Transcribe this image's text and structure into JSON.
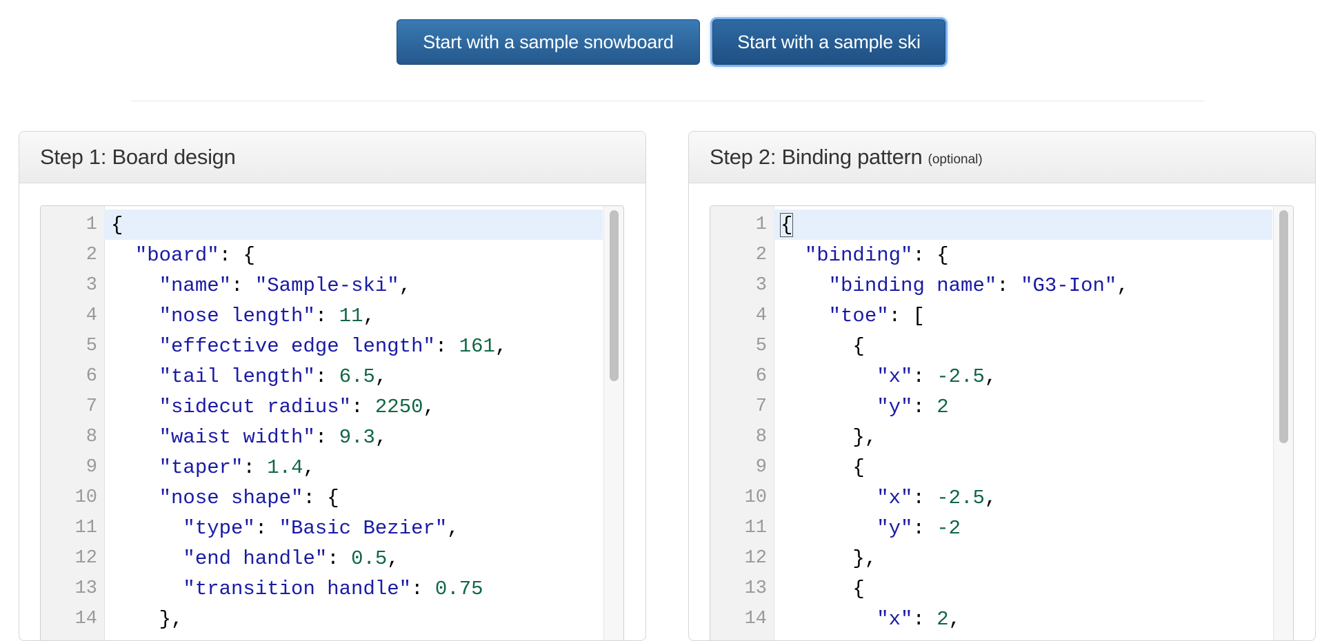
{
  "buttons": {
    "snowboard": "Start with a sample snowboard",
    "ski": "Start with a sample ski"
  },
  "panel1": {
    "title": "Step 1: Board design",
    "lines": [
      [
        [
          "p",
          "{"
        ]
      ],
      [
        [
          "p",
          "  "
        ],
        [
          "k",
          "\"board\""
        ],
        [
          "p",
          ": {"
        ]
      ],
      [
        [
          "p",
          "    "
        ],
        [
          "k",
          "\"name\""
        ],
        [
          "p",
          ": "
        ],
        [
          "s",
          "\"Sample-ski\""
        ],
        [
          "p",
          ","
        ]
      ],
      [
        [
          "p",
          "    "
        ],
        [
          "k",
          "\"nose length\""
        ],
        [
          "p",
          ": "
        ],
        [
          "n",
          "11"
        ],
        [
          "p",
          ","
        ]
      ],
      [
        [
          "p",
          "    "
        ],
        [
          "k",
          "\"effective edge length\""
        ],
        [
          "p",
          ": "
        ],
        [
          "n",
          "161"
        ],
        [
          "p",
          ","
        ]
      ],
      [
        [
          "p",
          "    "
        ],
        [
          "k",
          "\"tail length\""
        ],
        [
          "p",
          ": "
        ],
        [
          "n",
          "6.5"
        ],
        [
          "p",
          ","
        ]
      ],
      [
        [
          "p",
          "    "
        ],
        [
          "k",
          "\"sidecut radius\""
        ],
        [
          "p",
          ": "
        ],
        [
          "n",
          "2250"
        ],
        [
          "p",
          ","
        ]
      ],
      [
        [
          "p",
          "    "
        ],
        [
          "k",
          "\"waist width\""
        ],
        [
          "p",
          ": "
        ],
        [
          "n",
          "9.3"
        ],
        [
          "p",
          ","
        ]
      ],
      [
        [
          "p",
          "    "
        ],
        [
          "k",
          "\"taper\""
        ],
        [
          "p",
          ": "
        ],
        [
          "n",
          "1.4"
        ],
        [
          "p",
          ","
        ]
      ],
      [
        [
          "p",
          "    "
        ],
        [
          "k",
          "\"nose shape\""
        ],
        [
          "p",
          ": {"
        ]
      ],
      [
        [
          "p",
          "      "
        ],
        [
          "k",
          "\"type\""
        ],
        [
          "p",
          ": "
        ],
        [
          "s",
          "\"Basic Bezier\""
        ],
        [
          "p",
          ","
        ]
      ],
      [
        [
          "p",
          "      "
        ],
        [
          "k",
          "\"end handle\""
        ],
        [
          "p",
          ": "
        ],
        [
          "n",
          "0.5"
        ],
        [
          "p",
          ","
        ]
      ],
      [
        [
          "p",
          "      "
        ],
        [
          "k",
          "\"transition handle\""
        ],
        [
          "p",
          ": "
        ],
        [
          "n",
          "0.75"
        ]
      ],
      [
        [
          "p",
          "    },"
        ]
      ]
    ]
  },
  "panel2": {
    "title": "Step 2: Binding pattern",
    "subtitle": "(optional)",
    "lines": [
      [
        [
          "p",
          "{"
        ]
      ],
      [
        [
          "p",
          "  "
        ],
        [
          "k",
          "\"binding\""
        ],
        [
          "p",
          ": {"
        ]
      ],
      [
        [
          "p",
          "    "
        ],
        [
          "k",
          "\"binding name\""
        ],
        [
          "p",
          ": "
        ],
        [
          "s",
          "\"G3-Ion\""
        ],
        [
          "p",
          ","
        ]
      ],
      [
        [
          "p",
          "    "
        ],
        [
          "k",
          "\"toe\""
        ],
        [
          "p",
          ": ["
        ]
      ],
      [
        [
          "p",
          "      {"
        ]
      ],
      [
        [
          "p",
          "        "
        ],
        [
          "k",
          "\"x\""
        ],
        [
          "p",
          ": "
        ],
        [
          "n",
          "-2.5"
        ],
        [
          "p",
          ","
        ]
      ],
      [
        [
          "p",
          "        "
        ],
        [
          "k",
          "\"y\""
        ],
        [
          "p",
          ": "
        ],
        [
          "n",
          "2"
        ]
      ],
      [
        [
          "p",
          "      },"
        ]
      ],
      [
        [
          "p",
          "      {"
        ]
      ],
      [
        [
          "p",
          "        "
        ],
        [
          "k",
          "\"x\""
        ],
        [
          "p",
          ": "
        ],
        [
          "n",
          "-2.5"
        ],
        [
          "p",
          ","
        ]
      ],
      [
        [
          "p",
          "        "
        ],
        [
          "k",
          "\"y\""
        ],
        [
          "p",
          ": "
        ],
        [
          "n",
          "-2"
        ]
      ],
      [
        [
          "p",
          "      },"
        ]
      ],
      [
        [
          "p",
          "      {"
        ]
      ],
      [
        [
          "p",
          "        "
        ],
        [
          "k",
          "\"x\""
        ],
        [
          "p",
          ": "
        ],
        [
          "n",
          "2"
        ],
        [
          "p",
          ","
        ]
      ]
    ]
  }
}
